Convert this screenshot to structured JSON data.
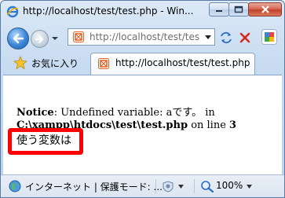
{
  "window": {
    "title": "http://localhost/test/test.php - Win...",
    "minimize_label": "minimize",
    "maximize_label": "maximize",
    "close_label": "close"
  },
  "address_bar": {
    "url": "http://localhost/test/tes"
  },
  "favorites": {
    "label": "お気に入り"
  },
  "tab": {
    "label": "http://localhost/test/test.php"
  },
  "content": {
    "notice_label": "Notice",
    "notice_message": ": Undefined variable: aです。 in",
    "file_path": "C:\\xampp\\htdocs\\test\\test.php",
    "on_line": " on line ",
    "line_number": "3",
    "output": "使う変数は"
  },
  "status_bar": {
    "zone": "インターネット | 保護モード: ...",
    "zoom": "100%"
  },
  "colors": {
    "highlight": "#ff0000",
    "window_frame": "#5a7ba4"
  }
}
